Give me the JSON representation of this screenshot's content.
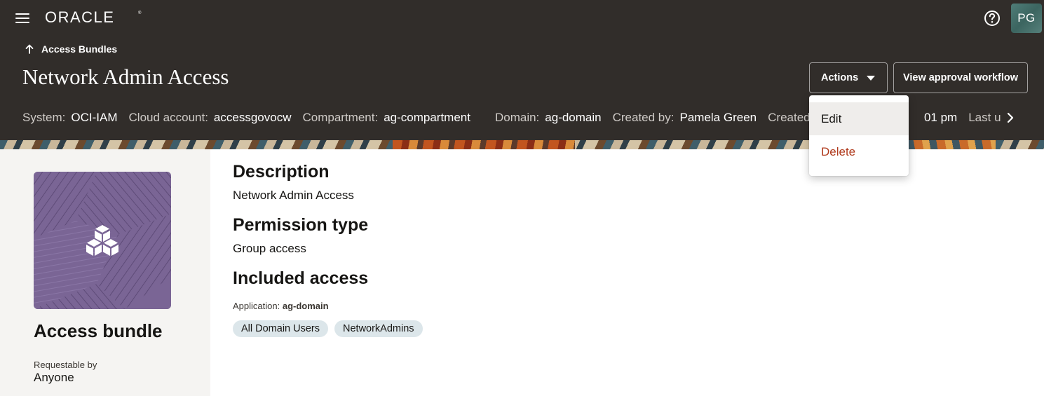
{
  "header": {
    "logo_text": "ORACLE",
    "avatar_initials": "PG",
    "menu_icon": "hamburger-menu-icon",
    "help_icon": "help-icon"
  },
  "breadcrumb": {
    "label": "Access Bundles",
    "icon": "arrow-up-icon"
  },
  "page": {
    "title": "Network Admin Access"
  },
  "toolbar": {
    "actions_label": "Actions",
    "workflow_label": "View approval workflow"
  },
  "actions_menu": {
    "items": [
      {
        "label": "Edit"
      },
      {
        "label": "Delete"
      }
    ]
  },
  "meta": {
    "system_label": "System:",
    "system_value": "OCI-IAM",
    "cloud_label": "Cloud account:",
    "cloud_value": "accessgovocw",
    "compartment_label": "Compartment:",
    "compartment_value": "ag-compartment",
    "domain_label": "Domain:",
    "domain_value": "ag-domain",
    "created_by_label": "Created by:",
    "created_by_value": "Pamela Green",
    "created_on_label": "Created on:",
    "created_on_value": "01 pm",
    "last_updated_label": "Last upd"
  },
  "side_panel": {
    "title": "Access bundle",
    "requestable_label": "Requestable by",
    "requestable_value": "Anyone",
    "image_icon": "cube-cluster-icon"
  },
  "details": {
    "description_heading": "Description",
    "description_text": "Network Admin Access",
    "permission_heading": "Permission type",
    "permission_text": "Group access",
    "included_heading": "Included access",
    "application_label": "Application:",
    "application_value": "ag-domain",
    "groups": [
      "All Domain Users",
      "NetworkAdmins"
    ]
  },
  "colors": {
    "header_bg": "#312d2a",
    "panel_bg": "#f5f4f2",
    "chip_bg": "#dce6ea",
    "delete_text": "#b03a1c",
    "bundle_tile": "#7a6595"
  }
}
